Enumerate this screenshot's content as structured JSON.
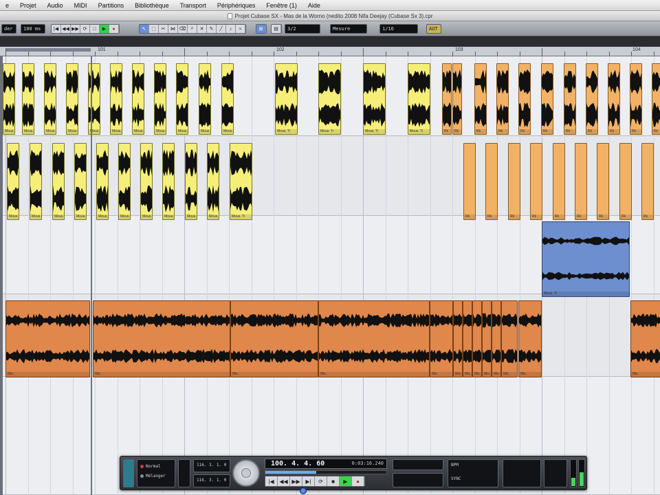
{
  "menubar": {
    "items": [
      "e",
      "Projet",
      "Audio",
      "MIDI",
      "Partitions",
      "Bibliothèque",
      "Transport",
      "Périphériques",
      "Fenêtre (1)",
      "Aide"
    ]
  },
  "window": {
    "title": "Projet Cubase SX - Mas de la Worno (nedito 2008 Nifa Deejay (Cubase Sx 3).cpr"
  },
  "toolbar": {
    "field_a": "der",
    "field_b": "100 ms",
    "quantize": "3/2",
    "snap_mode": "Mesure",
    "grid_value": "1/16",
    "tempo_badge": "AUT"
  },
  "ruler": {
    "bar_labels": [
      "101",
      "102",
      "103",
      "104"
    ]
  },
  "transport": {
    "mode_normal": "Normal",
    "mode_mix": "Mélanger",
    "left_locator": "116. 3. 1. 0",
    "right_locator": "116. 3. 1. 0",
    "position_bars": "100. 4. 4. 60",
    "position_time": "0:03:16.240",
    "progress": 0.42,
    "tempo_label": "BPM",
    "sync_label": "SYNC"
  },
  "events": {
    "yellow_label": "Mous. Ti",
    "orange_label": "Rk",
    "blue_label": "Mous. Ti",
    "rust_label": "Mix."
  },
  "colors": {
    "accent_blue": "#6d8ecf",
    "event_yellow": "#f5ef7a",
    "event_orange": "#f2b266",
    "event_rust": "#e0874b",
    "play_green": "#39d452",
    "record_red": "#d11c1c"
  }
}
